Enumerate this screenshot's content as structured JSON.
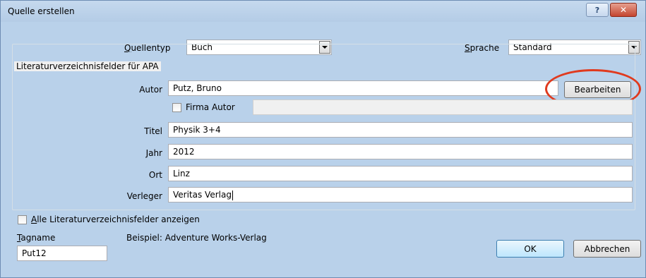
{
  "window": {
    "title": "Quelle erstellen",
    "help_glyph": "?",
    "close_glyph": "✕"
  },
  "source_type": {
    "label": "Quellentyp",
    "value": "Buch"
  },
  "language": {
    "label": "Sprache",
    "value": "Standard"
  },
  "group": {
    "title": "Literaturverzeichnisfelder für APA",
    "author": {
      "label": "Autor",
      "value": "Putz, Bruno",
      "edit_button": "Bearbeiten"
    },
    "corporate_author": {
      "label": "Firma Autor",
      "checked": false,
      "value": ""
    },
    "title_field": {
      "label": "Titel",
      "value": "Physik 3+4"
    },
    "year": {
      "label": "Jahr",
      "value": "2012"
    },
    "city": {
      "label": "Ort",
      "value": "Linz"
    },
    "publisher": {
      "label": "Verleger",
      "value": "Veritas Verlag"
    }
  },
  "show_all": {
    "label": "Alle Literaturverzeichnisfelder anzeigen",
    "checked": false
  },
  "tag": {
    "label": "Tagname",
    "value": "Put12"
  },
  "example": {
    "text": "Beispiel: Adventure Works-Verlag"
  },
  "buttons": {
    "ok": "OK",
    "cancel": "Abbrechen"
  },
  "colors": {
    "annotation_circle": "#e03a1e",
    "window_frame": "#b9d1ea"
  }
}
